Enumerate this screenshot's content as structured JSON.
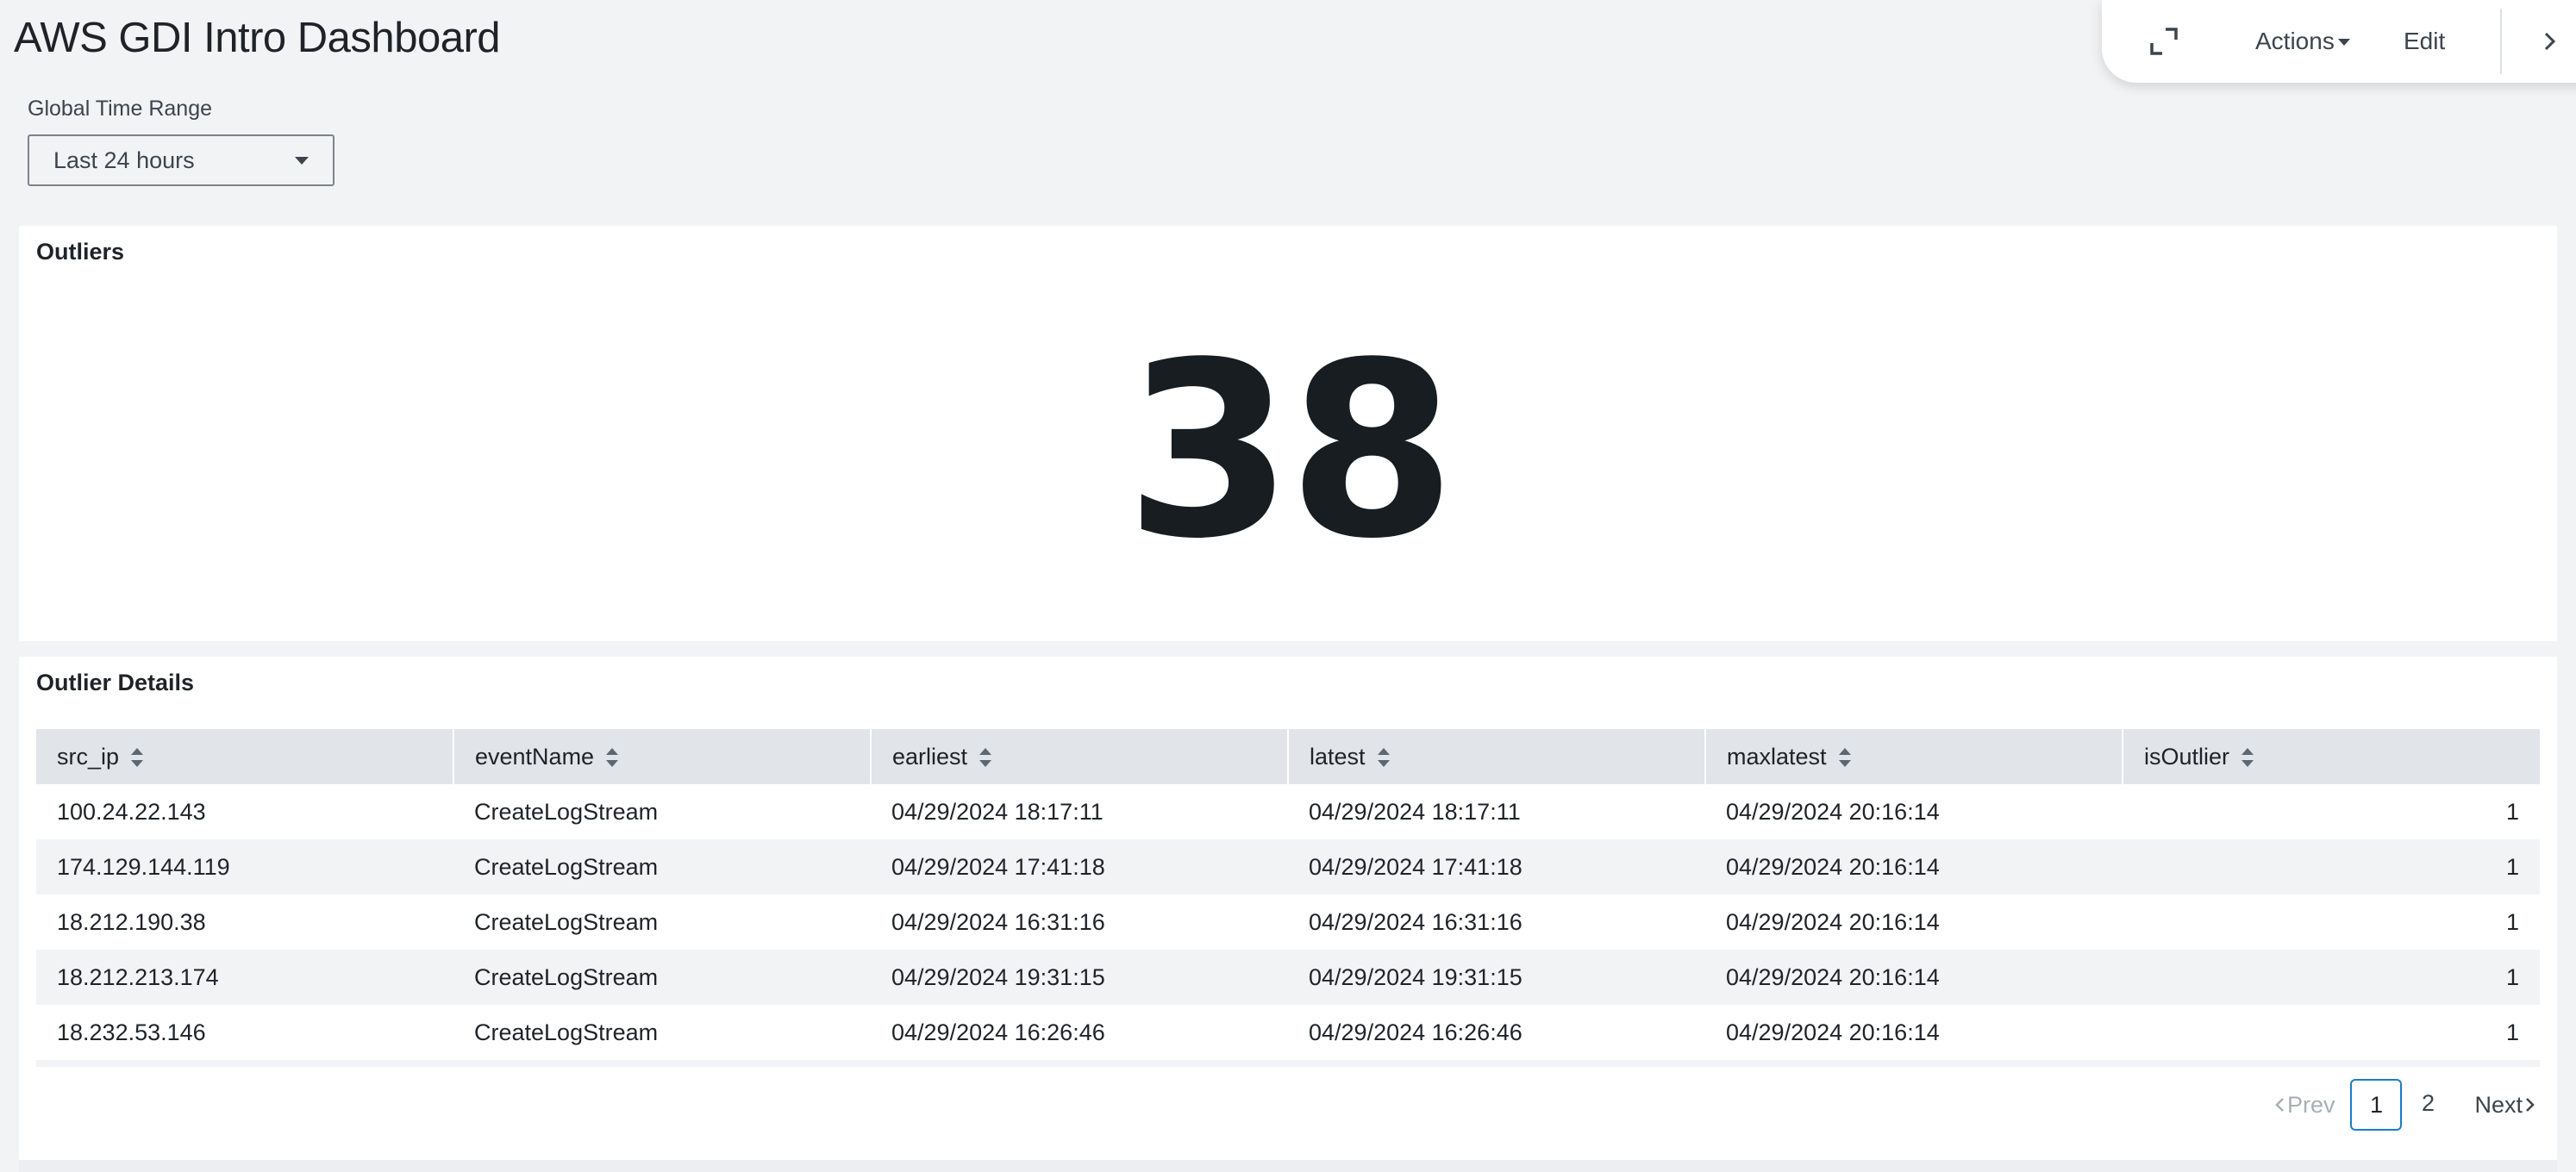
{
  "dashboard": {
    "title": "AWS GDI Intro Dashboard"
  },
  "toolbar": {
    "expand_icon": "expand-icon",
    "actions_label": "Actions",
    "edit_label": "Edit",
    "collapse_icon": "chevron-right-icon"
  },
  "time_range": {
    "label": "Global Time Range",
    "value": "Last 24 hours"
  },
  "outliers_panel": {
    "title": "Outliers",
    "value": "38"
  },
  "details_panel": {
    "title": "Outlier Details",
    "columns": [
      "src_ip",
      "eventName",
      "earliest",
      "latest",
      "maxlatest",
      "isOutlier"
    ],
    "rows": [
      [
        "100.24.22.143",
        "CreateLogStream",
        "04/29/2024 18:17:11",
        "04/29/2024 18:17:11",
        "04/29/2024 20:16:14",
        "1"
      ],
      [
        "174.129.144.119",
        "CreateLogStream",
        "04/29/2024 17:41:18",
        "04/29/2024 17:41:18",
        "04/29/2024 20:16:14",
        "1"
      ],
      [
        "18.212.190.38",
        "CreateLogStream",
        "04/29/2024 16:31:16",
        "04/29/2024 16:31:16",
        "04/29/2024 20:16:14",
        "1"
      ],
      [
        "18.212.213.174",
        "CreateLogStream",
        "04/29/2024 19:31:15",
        "04/29/2024 19:31:15",
        "04/29/2024 20:16:14",
        "1"
      ],
      [
        "18.232.53.146",
        "CreateLogStream",
        "04/29/2024 16:26:46",
        "04/29/2024 16:26:46",
        "04/29/2024 20:16:14",
        "1"
      ]
    ]
  },
  "pagination": {
    "prev_label": "Prev",
    "pages": [
      "1",
      "2"
    ],
    "current_page": "1",
    "next_label": "Next"
  },
  "colors": {
    "background": "#f2f3f5",
    "panel": "#ffffff",
    "header_row": "#e1e5e9",
    "active_page_border": "#1a7fc4"
  }
}
